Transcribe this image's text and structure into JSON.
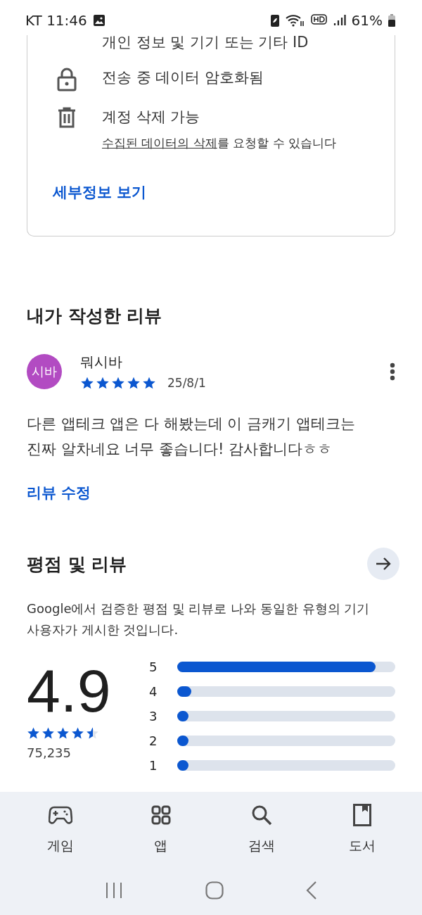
{
  "status_bar": {
    "carrier_time": "KT 11:46",
    "battery": "61%"
  },
  "data_safety": {
    "items": [
      {
        "kind": "plain",
        "title": "개인 정보 및 기기 또는 기타 ID"
      },
      {
        "kind": "lock",
        "title": "전송 중 데이터 암호화됨"
      },
      {
        "kind": "trash",
        "title": "계정 삭제 가능",
        "subtitle": "**수집된 데이터의 삭제**를 요청할 수 있습니다"
      }
    ],
    "link": "세부정보 보기"
  },
  "my_review": {
    "heading": "내가 작성한 리뷰",
    "avatar": {
      "text": "시바",
      "color": "#b24bc2"
    },
    "author": "뭐시바",
    "stars": 5,
    "date": "25/8/1",
    "text": "다른 앱테크 앱은 다 해봤는데 이 금캐기 앱테크는 진짜 알차네요 너무 좋습니다! 감사합니다ㅎㅎ",
    "edit_link": "리뷰 수정"
  },
  "ratings": {
    "heading": "평점 및 리뷰",
    "description": "Google에서 검증한 평점 및 리뷰로 나와 동일한 유형의 기기 사용자가 게시한 것입니다.",
    "score": "4.9",
    "stars": 4.5,
    "count": "75,235",
    "bars": [
      {
        "label": "5",
        "level": 0.91
      },
      {
        "label": "4",
        "level": 0.065
      },
      {
        "label": "3",
        "level": 0.05
      },
      {
        "label": "2",
        "level": 0.05
      },
      {
        "label": "1",
        "level": 0.05
      }
    ]
  },
  "bottom_nav": [
    {
      "kind": "games",
      "label": "게임"
    },
    {
      "kind": "apps",
      "label": "앱"
    },
    {
      "kind": "search",
      "label": "검색"
    },
    {
      "kind": "books",
      "label": "도서"
    }
  ]
}
